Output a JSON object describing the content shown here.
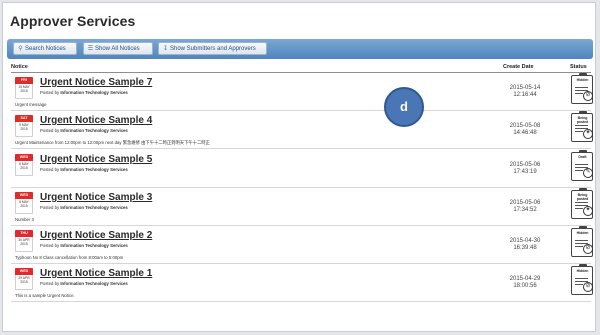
{
  "page": {
    "title": "Approver Services"
  },
  "toolbar": {
    "search": "Search Notices",
    "show_all": "Show All Notices",
    "show_submitters": "Show Submitters and Approvers"
  },
  "table": {
    "col_notice": "Notice",
    "col_create_date": "Create Date",
    "col_status": "Status"
  },
  "floating_button": {
    "label": "d"
  },
  "notices": [
    {
      "day": "FRI",
      "date": "15 MAY",
      "year": "2015",
      "title": "Urgent Notice Sample 7",
      "posted_prefix": "Posted by",
      "posted_by": "Information Technology Services",
      "description": "Urgent message",
      "create_date": "2015-05-14",
      "create_time": "12:16:44",
      "status": "Hidden",
      "status_icon": "no-entry-icon"
    },
    {
      "day": "SAT",
      "date": "9 MAY",
      "year": "2015",
      "title": "Urgent Notice Sample 4",
      "posted_prefix": "Posted by",
      "posted_by": "Information Technology Services",
      "description": "Urgent Maintenance from 12:00pm to 12:00pm next day 緊急維修 由下午十二時正到明天下午十二時正",
      "create_date": "2015-05-08",
      "create_time": "14:46:48",
      "status": "Being posted",
      "status_icon": "pin-icon"
    },
    {
      "day": "WED",
      "date": "6 MAY",
      "year": "2015",
      "title": "Urgent Notice Sample 5",
      "posted_prefix": "Posted by",
      "posted_by": "Information Technology Services",
      "description": "",
      "create_date": "2015-05-06",
      "create_time": "17:43:19",
      "status": "Draft",
      "status_icon": "pencil-icon"
    },
    {
      "day": "WED",
      "date": "6 MAY",
      "year": "2015",
      "title": "Urgent Notice Sample 3",
      "posted_prefix": "Posted by",
      "posted_by": "Information Technology Services",
      "description": "Number 3",
      "create_date": "2015-05-06",
      "create_time": "17:34:52",
      "status": "Being posted",
      "status_icon": "pin-icon"
    },
    {
      "day": "THU",
      "date": "30 APR",
      "year": "2015",
      "title": "Urgent Notice Sample 2",
      "posted_prefix": "Posted by",
      "posted_by": "Information Technology Services",
      "description": "Typhoon No 8 Class cancellation from 8:00am to 5:00pm",
      "create_date": "2015-04-30",
      "create_time": "16:39:48",
      "status": "Hidden",
      "status_icon": "no-entry-icon"
    },
    {
      "day": "WED",
      "date": "29 APR",
      "year": "2015",
      "title": "Urgent Notice Sample 1",
      "posted_prefix": "Posted by",
      "posted_by": "Information Technology Services",
      "description": "This is a sample Urgent Notice.",
      "create_date": "2015-04-29",
      "create_time": "18:00:56",
      "status": "Hidden",
      "status_icon": "no-entry-icon"
    }
  ],
  "colors": {
    "toolbar": "#5a8cc4",
    "calendar_red": "#e02b2b",
    "accent_circle": "#4b76b6"
  }
}
